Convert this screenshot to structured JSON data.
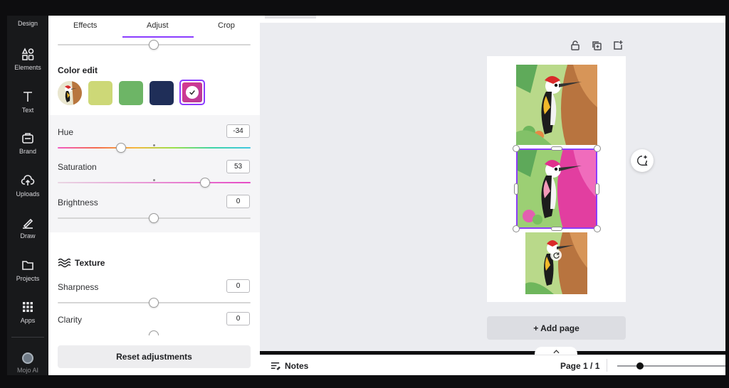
{
  "sidebar": {
    "items": [
      {
        "label": "Design",
        "icon": "design-icon"
      },
      {
        "label": "Elements",
        "icon": "elements-icon"
      },
      {
        "label": "Text",
        "icon": "text-icon"
      },
      {
        "label": "Brand",
        "icon": "brand-icon"
      },
      {
        "label": "Uploads",
        "icon": "cloud-upload-icon"
      },
      {
        "label": "Draw",
        "icon": "pen-icon"
      },
      {
        "label": "Projects",
        "icon": "folder-icon"
      },
      {
        "label": "Apps",
        "icon": "apps-grid-icon"
      },
      {
        "label": "Mojo AI",
        "icon": "avatar-icon"
      }
    ]
  },
  "panel": {
    "tabs": [
      {
        "label": "Effects"
      },
      {
        "label": "Adjust"
      },
      {
        "label": "Crop"
      }
    ],
    "active_tab": "Adjust",
    "color_edit": {
      "title": "Color edit",
      "swatches": [
        "#cdd877",
        "#6db566",
        "#1f2e58",
        "#d6398f"
      ],
      "selected_swatch": 3
    },
    "hue": {
      "label": "Hue",
      "value": "-34"
    },
    "saturation": {
      "label": "Saturation",
      "value": "53"
    },
    "brightness": {
      "label": "Brightness",
      "value": "0"
    },
    "texture": {
      "title": "Texture",
      "icon": "waves-icon"
    },
    "sharpness": {
      "label": "Sharpness",
      "value": "0"
    },
    "clarity": {
      "label": "Clarity",
      "value": "0"
    },
    "reset_label": "Reset adjustments"
  },
  "canvas": {
    "tools": [
      "lock-icon",
      "duplicate-icon",
      "add-page-icon"
    ],
    "add_page_label": "+ Add page",
    "comment_icon": "add-comment-icon"
  },
  "bottombar": {
    "notes_label": "Notes",
    "page_indicator": "Page 1 / 1"
  },
  "colors": {
    "accent": "#8b3dff",
    "sidebar_bg": "#18191b",
    "workspace_bg": "#ebecf0"
  }
}
